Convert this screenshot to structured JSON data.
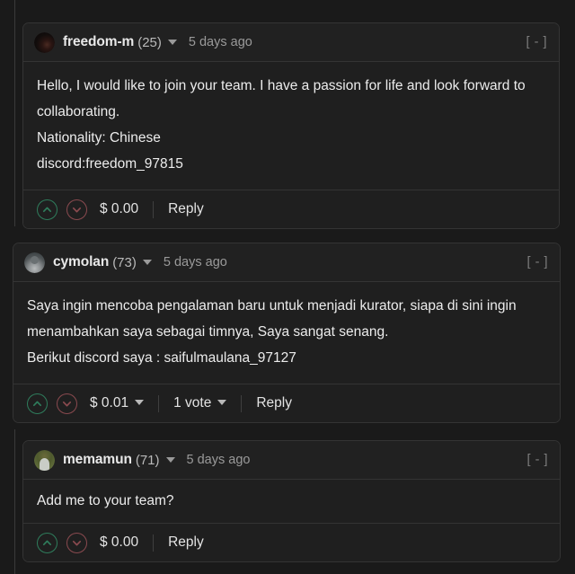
{
  "theme": {
    "page_background": "#1a1a1a",
    "card_background": "#1f1f1f",
    "card_border": "#343434",
    "text_primary": "#ececec",
    "text_muted": "#9a9a9a",
    "upvote_color": "#2f7d5c",
    "downvote_color": "#8a4a4f"
  },
  "comments": [
    {
      "author": "freedom-m",
      "reputation": "(25)",
      "timestamp": "5 days ago",
      "collapse_label": "[ - ]",
      "avatar_style": "av-dark",
      "body_lines": [
        "Hello, I would like to join your team. I have a passion for life and look forward to collaborating.",
        "Nationality: Chinese",
        "discord:freedom_97815"
      ],
      "payout": "$ 0.00",
      "payout_has_caret": false,
      "votes": "",
      "has_votes": false,
      "reply_label": "Reply",
      "nested": true
    },
    {
      "author": "cymolan",
      "reputation": "(73)",
      "timestamp": "5 days ago",
      "collapse_label": "[ - ]",
      "avatar_style": "av-gray",
      "body_lines": [
        "Saya ingin mencoba pengalaman baru untuk menjadi kurator, siapa di sini ingin menambahkan saya sebagai timnya, Saya sangat senang.",
        "Berikut discord saya : saifulmaulana_97127"
      ],
      "payout": "$ 0.01",
      "payout_has_caret": true,
      "votes": "1 vote",
      "has_votes": true,
      "reply_label": "Reply",
      "nested": false
    },
    {
      "author": "memamun",
      "reputation": "(71)",
      "timestamp": "5 days ago",
      "collapse_label": "[ - ]",
      "avatar_style": "av-green",
      "body_lines": [
        "Add me to your team?"
      ],
      "payout": "$ 0.00",
      "payout_has_caret": false,
      "votes": "",
      "has_votes": false,
      "reply_label": "Reply",
      "nested": true
    }
  ]
}
